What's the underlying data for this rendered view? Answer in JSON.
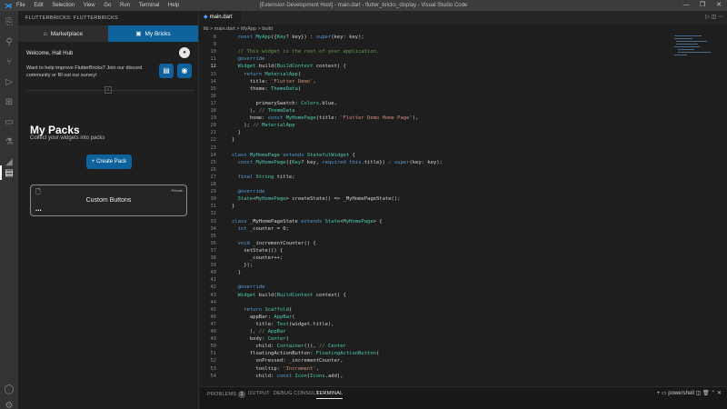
{
  "titlebar": {
    "menu": [
      "File",
      "Edit",
      "Selection",
      "View",
      "Go",
      "Run",
      "Terminal",
      "Help"
    ],
    "title": "[Extension Development Host] - main.dart - flutter_bricks_display - Visual Studio Code"
  },
  "sidebar": {
    "header": "FLUTTERBRICKS: FLUTTERBRICKS",
    "tab_marketplace": "Marketplace",
    "tab_mybricks": "My Bricks",
    "welcome": "Welcome, Hall Hub",
    "improve": "Want to help improve FlutterBricks? Join our discord community or fill out our survey!",
    "packs_title": "My Packs",
    "packs_subtitle": "Collect your widgets into packs",
    "create_button": "+ Create Pack",
    "card_name": "Custom Buttons",
    "card_badge": "Private",
    "card_menu": "..."
  },
  "editor": {
    "tab_label": "main.dart",
    "breadcrumb": "lib > main.dart > MyApp > build"
  },
  "code_lines": [
    {
      "n": "8",
      "t": "  const MyApp({Key? key}) : super(key: key);"
    },
    {
      "n": "9",
      "t": ""
    },
    {
      "n": "10",
      "t": "  // This widget is the root of your application."
    },
    {
      "n": "11",
      "t": "  @override"
    },
    {
      "n": "12",
      "t": "  Widget build(BuildContext context) {"
    },
    {
      "n": "13",
      "t": "    return MaterialApp("
    },
    {
      "n": "14",
      "t": "      title: 'Flutter Demo',"
    },
    {
      "n": "15",
      "t": "      theme: ThemeData("
    },
    {
      "n": "16",
      "t": ""
    },
    {
      "n": "17",
      "t": "        primarySwatch: Colors.blue,"
    },
    {
      "n": "18",
      "t": "      ), // ThemeData"
    },
    {
      "n": "19",
      "t": "      home: const MyHomePage(title: 'Flutter Demo Home Page'),"
    },
    {
      "n": "20",
      "t": "    ); // MaterialApp"
    },
    {
      "n": "21",
      "t": "  }"
    },
    {
      "n": "22",
      "t": "}"
    },
    {
      "n": "23",
      "t": ""
    },
    {
      "n": "24",
      "t": "class MyHomePage extends StatefulWidget {"
    },
    {
      "n": "25",
      "t": "  const MyHomePage({Key? key, required this.title}) : super(key: key);"
    },
    {
      "n": "26",
      "t": ""
    },
    {
      "n": "27",
      "t": "  final String title;"
    },
    {
      "n": "28",
      "t": ""
    },
    {
      "n": "29",
      "t": "  @override"
    },
    {
      "n": "30",
      "t": "  State<MyHomePage> createState() => _MyHomePageState();"
    },
    {
      "n": "31",
      "t": "}"
    },
    {
      "n": "32",
      "t": ""
    },
    {
      "n": "33",
      "t": "class _MyHomePageState extends State<MyHomePage> {"
    },
    {
      "n": "34",
      "t": "  int _counter = 0;"
    },
    {
      "n": "35",
      "t": ""
    },
    {
      "n": "36",
      "t": "  void _incrementCounter() {"
    },
    {
      "n": "37",
      "t": "    setState(() {"
    },
    {
      "n": "38",
      "t": "      _counter++;"
    },
    {
      "n": "39",
      "t": "    });"
    },
    {
      "n": "40",
      "t": "  }"
    },
    {
      "n": "41",
      "t": ""
    },
    {
      "n": "42",
      "t": "  @override"
    },
    {
      "n": "43",
      "t": "  Widget build(BuildContext context) {"
    },
    {
      "n": "44",
      "t": ""
    },
    {
      "n": "45",
      "t": "    return Scaffold("
    },
    {
      "n": "46",
      "t": "      appBar: AppBar("
    },
    {
      "n": "47",
      "t": "        title: Text(widget.title),"
    },
    {
      "n": "48",
      "t": "      ), // AppBar"
    },
    {
      "n": "49",
      "t": "      body: Center("
    },
    {
      "n": "50",
      "t": "        child: Container()), // Center"
    },
    {
      "n": "51",
      "t": "      floatingActionButton: FloatingActionButton("
    },
    {
      "n": "52",
      "t": "        onPressed: _incrementCounter,"
    },
    {
      "n": "53",
      "t": "        tooltip: 'Increment',"
    },
    {
      "n": "54",
      "t": "        child: const Icon(Icons.add),"
    }
  ],
  "panel": {
    "problems": "PROBLEMS",
    "problems_count": "1",
    "output": "OUTPUT",
    "debug": "DEBUG CONSOLE",
    "terminal": "TERMINAL",
    "shell": "powershell"
  },
  "colors": {
    "accent": "#0e639c",
    "sidebar_bg": "#1f1f1f",
    "editor_bg": "#1e1e1e"
  }
}
